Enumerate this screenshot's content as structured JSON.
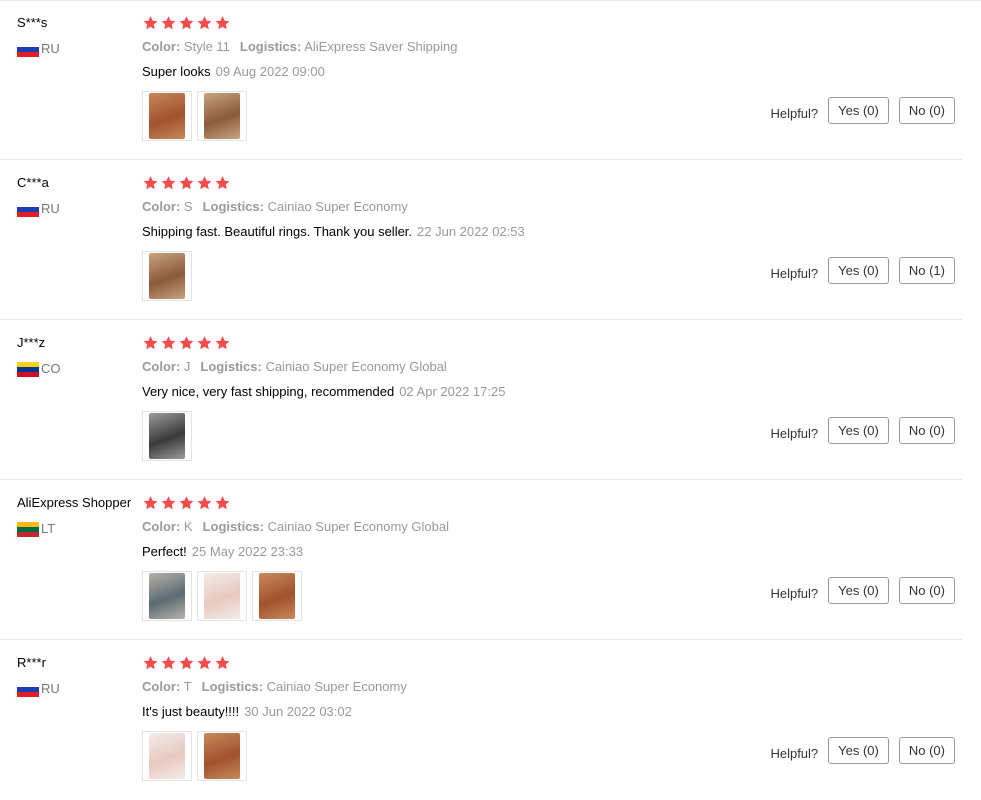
{
  "colors": {
    "star": "#f44d4d",
    "muted": "#999999",
    "border": "#e8e8e8"
  },
  "helpful_label": "Helpful?",
  "reviews": [
    {
      "user": "S***s",
      "country": "RU",
      "flag": [
        "#ffffff",
        "#1c3fb4",
        "#e41e26"
      ],
      "stars": 5,
      "color_label": "Color:",
      "color_value": "Style 11",
      "logistics_label": "Logistics:",
      "logistics_value": "AliExpress Saver Shipping",
      "text": "Super looks",
      "date": "09 Aug 2022 09:00",
      "photo_icons": [
        "review-photo-icon",
        "review-photo-icon"
      ],
      "yes": "Yes (0)",
      "no": "No (0)"
    },
    {
      "user": "C***a",
      "country": "RU",
      "flag": [
        "#ffffff",
        "#1c3fb4",
        "#e41e26"
      ],
      "stars": 5,
      "color_label": "Color:",
      "color_value": "S",
      "logistics_label": "Logistics:",
      "logistics_value": "Cainiao Super Economy",
      "text": "Shipping fast. Beautiful rings. Thank you seller.",
      "date": "22 Jun 2022 02:53",
      "photo_icons": [
        "review-photo-icon"
      ],
      "yes": "Yes (0)",
      "no": "No (1)"
    },
    {
      "user": "J***z",
      "country": "CO",
      "flag": [
        "#fcd116",
        "#003893",
        "#ce1126"
      ],
      "stars": 5,
      "color_label": "Color:",
      "color_value": "J",
      "logistics_label": "Logistics:",
      "logistics_value": "Cainiao Super Economy Global",
      "text": "Very nice, very fast shipping, recommended",
      "date": "02 Apr 2022 17:25",
      "photo_icons": [
        "review-photo-icon"
      ],
      "yes": "Yes (0)",
      "no": "No (0)"
    },
    {
      "user": "AliExpress Shopper",
      "country": "LT",
      "flag": [
        "#fdb913",
        "#006a44",
        "#c1272d"
      ],
      "stars": 5,
      "color_label": "Color:",
      "color_value": "K",
      "logistics_label": "Logistics:",
      "logistics_value": "Cainiao Super Economy Global",
      "text": "Perfect!",
      "date": "25 May 2022 23:33",
      "photo_icons": [
        "review-photo-icon",
        "review-photo-icon",
        "review-photo-icon"
      ],
      "yes": "Yes (0)",
      "no": "No (0)"
    },
    {
      "user": "R***r",
      "country": "RU",
      "flag": [
        "#ffffff",
        "#1c3fb4",
        "#e41e26"
      ],
      "stars": 5,
      "color_label": "Color:",
      "color_value": "T",
      "logistics_label": "Logistics:",
      "logistics_value": "Cainiao Super Economy",
      "text": "It's just beauty!!!!",
      "date": "30 Jun 2022 03:02",
      "photo_icons": [
        "review-photo-icon",
        "review-photo-icon"
      ],
      "yes": "Yes (0)",
      "no": "No (0)"
    }
  ]
}
